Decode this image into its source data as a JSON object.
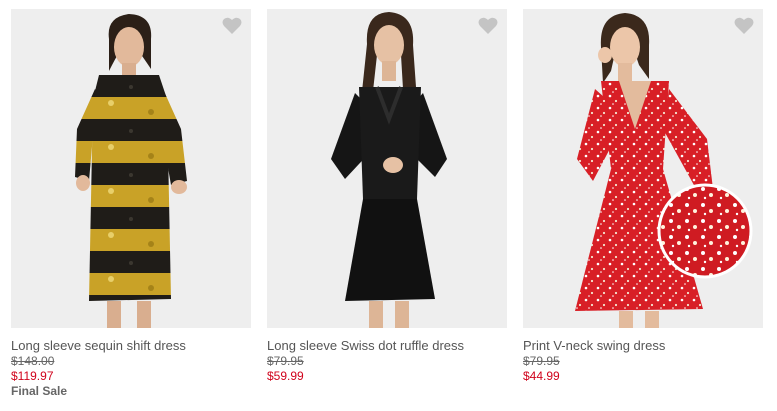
{
  "products": [
    {
      "name": "Long sleeve sequin shift dress",
      "original_price": "$148.00",
      "sale_price": "$119.97",
      "badge": "Final Sale",
      "icon": "heart-icon"
    },
    {
      "name": "Long sleeve Swiss dot ruffle dress",
      "original_price": "$79.95",
      "sale_price": "$59.99",
      "icon": "heart-icon"
    },
    {
      "name": "Print V-neck swing dress",
      "original_price": "$79.95",
      "sale_price": "$44.99",
      "icon": "heart-icon"
    }
  ],
  "colors": {
    "image_background": "#eeeeee",
    "heart": "#c4c4c4",
    "sale_price": "#d0021b",
    "text": "#555555"
  }
}
